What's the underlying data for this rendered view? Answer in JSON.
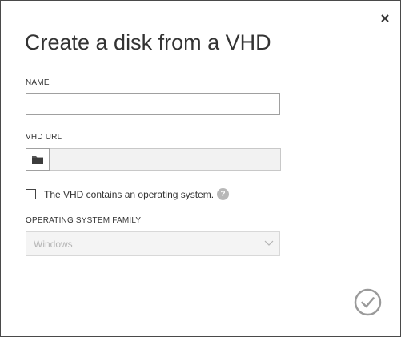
{
  "dialog": {
    "title": "Create a disk from a VHD",
    "close_icon": "close-icon",
    "confirm_icon": "checkmark-circle-icon"
  },
  "fields": {
    "name": {
      "label": "NAME",
      "value": "",
      "placeholder": ""
    },
    "vhd_url": {
      "label": "VHD URL",
      "value": "",
      "placeholder": "",
      "browse_icon": "folder-icon"
    },
    "contains_os": {
      "label": "The VHD contains an operating system.",
      "checked": false,
      "help_icon": "help-icon",
      "help_glyph": "?"
    },
    "os_family": {
      "label": "OPERATING SYSTEM FAMILY",
      "selected": "Windows",
      "disabled": true,
      "dropdown_icon": "chevron-down-icon"
    }
  },
  "colors": {
    "border": "#4a4a4a",
    "text": "#333333",
    "disabled_text": "#b4b4b4",
    "disabled_bg": "#f4f4f4",
    "help_icon_bg": "#b8b8b8",
    "confirm_icon": "#9a9a9a"
  }
}
